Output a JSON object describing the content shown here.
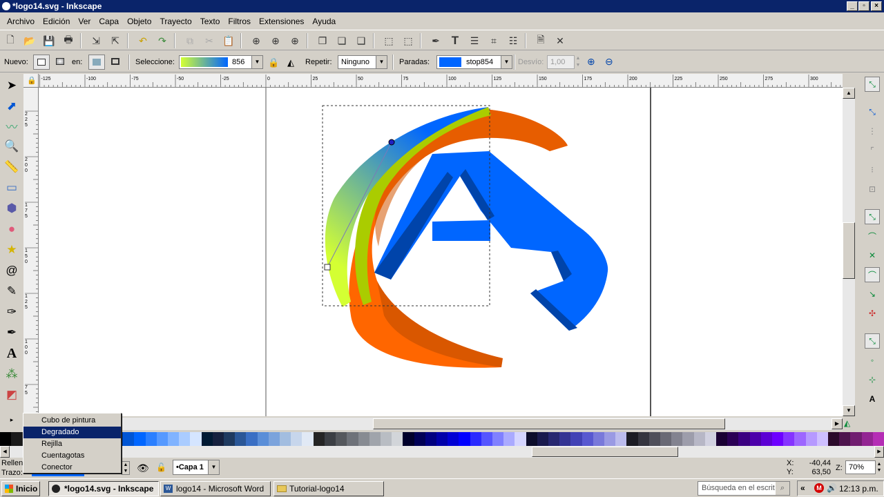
{
  "window": {
    "title": "*logo14.svg - Inkscape"
  },
  "menu": [
    "Archivo",
    "Edición",
    "Ver",
    "Capa",
    "Objeto",
    "Trayecto",
    "Texto",
    "Filtros",
    "Extensiones",
    "Ayuda"
  ],
  "gradient_toolbar": {
    "nuevo_label": "Nuevo:",
    "en_label": "en:",
    "seleccione_label": "Seleccione:",
    "gradient_value": "856",
    "repetir_label": "Repetir:",
    "repetir_value": "Ninguno",
    "paradas_label": "Paradas:",
    "stop_value": "stop854",
    "desvio_label": "Desvío:",
    "desvio_value": "1,00",
    "stop_color": "#0066ff"
  },
  "ruler": {
    "h_labels": [
      "-125",
      "-100",
      "-75",
      "-50",
      "-25",
      "0",
      "25",
      "50",
      "75",
      "100",
      "125",
      "150",
      "175",
      "200",
      "225",
      "250",
      "275",
      "300"
    ],
    "v_labels": [
      "2 2 5",
      "2 0 0",
      "1 7 5",
      "1 5 0",
      "1 2 5",
      "1 0 0",
      "7 5"
    ]
  },
  "context_menu": {
    "items": [
      "Cubo de pintura",
      "Degradado",
      "Rejilla",
      "Cuentagotas",
      "Conector"
    ],
    "selected": "Degradado"
  },
  "status": {
    "relleno_label": "Relleno:",
    "trazo_label": "Trazo:",
    "layer_value": "•Capa 1",
    "x_label": "X:",
    "x_value": "-40,44",
    "y_label": "Y:",
    "y_value": "63,50",
    "z_label": "Z:",
    "zoom_value": "70%"
  },
  "taskbar": {
    "start_label": "Inicio",
    "tasks": [
      "*logo14.svg - Inkscape",
      "logo14 - Microsoft Word",
      "Tutorial-logo14"
    ],
    "search_placeholder": "Búsqueda en el escrit",
    "clock": "12:13 p.m."
  },
  "palette_colors": [
    "#000000",
    "#1a1a1a",
    "#333333",
    "#4d4d4d",
    "#666666",
    "#808080",
    "#999999",
    "#b3b3b3",
    "#cccccc",
    "#e6e6e6",
    "#0044aa",
    "#0055d4",
    "#0066ff",
    "#2a7fff",
    "#5599ff",
    "#80b3ff",
    "#aaccff",
    "#d5e5ff",
    "#001a33",
    "#16213e",
    "#1f3a5f",
    "#2b5797",
    "#3a6fc4",
    "#5a8ed8",
    "#7ba3dc",
    "#a2bde0",
    "#c7d6ec",
    "#e1e9f5",
    "#252525",
    "#3c3f44",
    "#55585d",
    "#6e7279",
    "#878b92",
    "#a0a4ab",
    "#b9bdc3",
    "#d2d5d9",
    "#00002b",
    "#000055",
    "#000080",
    "#0000aa",
    "#0000d4",
    "#0000ff",
    "#2a2aff",
    "#5555ff",
    "#8080ff",
    "#aaaaff",
    "#d5d5ff",
    "#0d0d2b",
    "#1a1a4d",
    "#272770",
    "#343493",
    "#4141b5",
    "#5858d0",
    "#7979da",
    "#9a9ae3",
    "#bcbced",
    "#1c1c24",
    "#35353f",
    "#4f4f5a",
    "#696975",
    "#838390",
    "#9d9dab",
    "#b7b7c6",
    "#d1d1e0",
    "#1a0033",
    "#2b0055",
    "#3b0080",
    "#4c00aa",
    "#5c00d4",
    "#6d00ff",
    "#8533ff",
    "#9d66ff",
    "#b699ff",
    "#cebfff",
    "#2b0b2b",
    "#4d144d",
    "#701d70",
    "#932593",
    "#b52eb5"
  ]
}
